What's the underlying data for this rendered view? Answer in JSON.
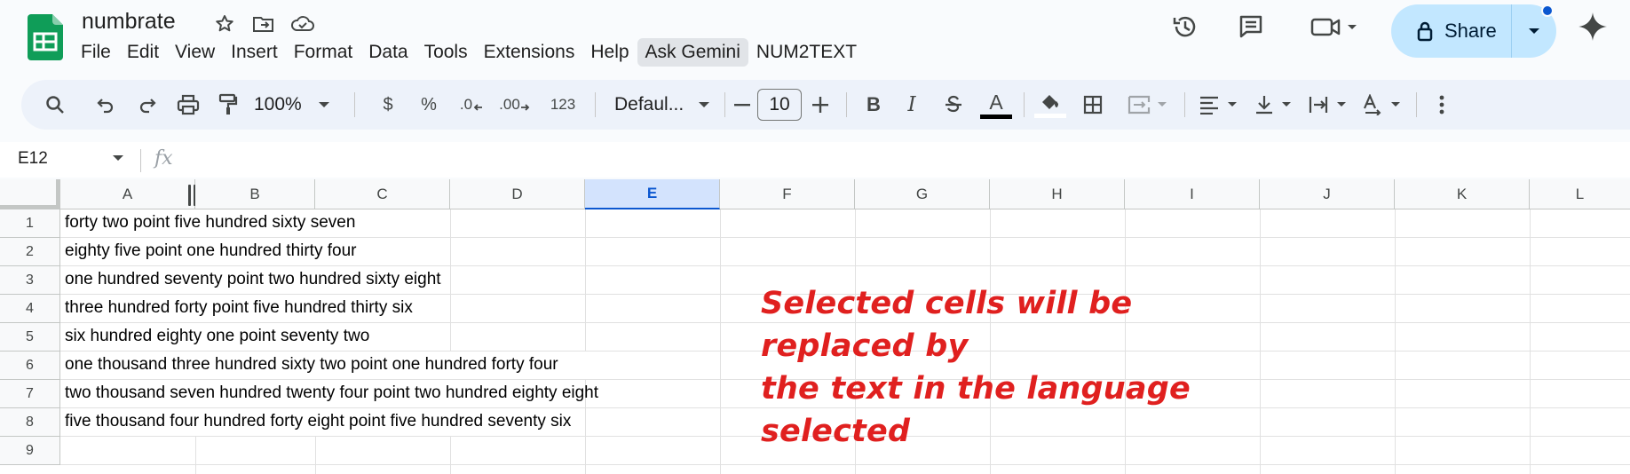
{
  "header": {
    "title": "numbrate",
    "menu": [
      "File",
      "Edit",
      "View",
      "Insert",
      "Format",
      "Data",
      "Tools",
      "Extensions",
      "Help",
      "Ask Gemini",
      "NUM2TEXT"
    ],
    "active_menu_index": 9,
    "share_label": "Share"
  },
  "toolbar": {
    "zoom": "100%",
    "currency": "$",
    "percent": "%",
    "decrease_decimal": ".0",
    "increase_decimal": ".00",
    "number_format": "123",
    "font": "Defaul...",
    "font_size": "10",
    "bold": "B",
    "italic": "I",
    "text_color_letter": "A"
  },
  "formula_bar": {
    "name_box": "E12",
    "fx": "fx"
  },
  "grid": {
    "columns": [
      "A",
      "B",
      "C",
      "D",
      "E",
      "F",
      "G",
      "H",
      "I",
      "J",
      "K",
      "L"
    ],
    "selected_column": "E",
    "rows": [
      "1",
      "2",
      "3",
      "4",
      "5",
      "6",
      "7",
      "8",
      "9"
    ],
    "cells_a": [
      "forty two point five hundred sixty seven",
      "eighty five point one hundred thirty four",
      "one hundred seventy point two hundred sixty eight",
      "three hundred forty point five hundred thirty six",
      "six hundred eighty one point seventy two",
      "one thousand three hundred sixty two point one hundred forty four",
      "two thousand seven hundred twenty four point two hundred eighty eight",
      "five thousand four hundred forty eight point five hundred seventy six",
      ""
    ]
  },
  "annotation": {
    "line1": "Selected cells will be replaced by",
    "line2": "the text in the language selected",
    "color": "#e0201f"
  },
  "colors": {
    "brand_green": "#0f9d58",
    "share_bg": "#c2e7ff",
    "selected_header": "#d3e3fd"
  }
}
